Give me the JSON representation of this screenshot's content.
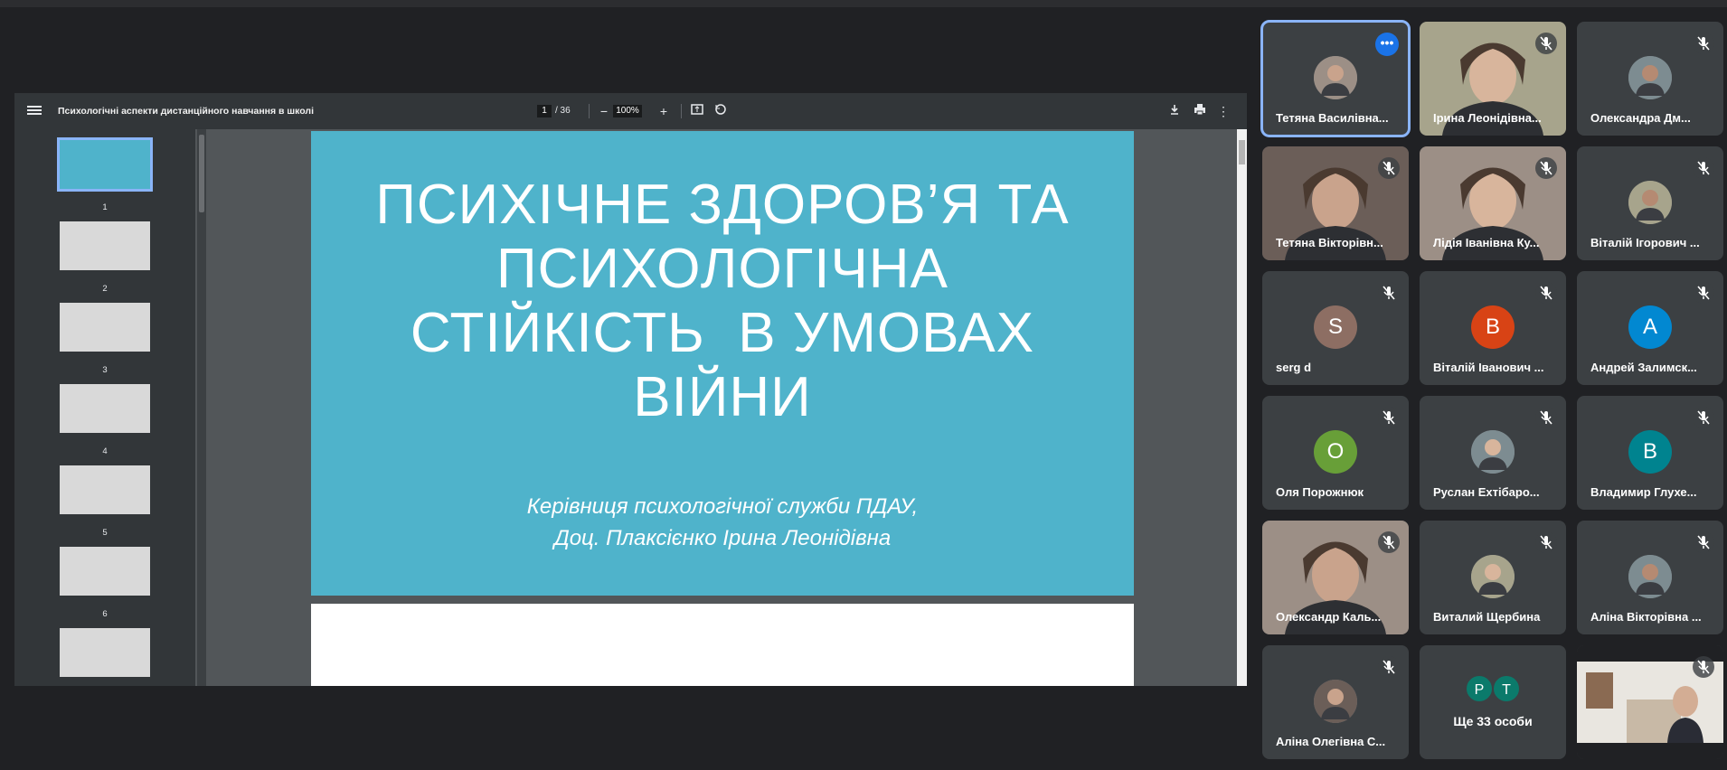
{
  "pdf": {
    "title": "Психологічні аспекти дистанційного навчання в школі",
    "current_page": "1",
    "page_total": "/ 36",
    "zoom": "100%",
    "thumbnails": [
      "1",
      "2",
      "3",
      "4",
      "5",
      "6"
    ],
    "slide": {
      "title_lines": [
        "ПСИХІЧНЕ ЗДОРОВ’Я ТА",
        "ПСИХОЛОГІЧНА",
        "СТІЙКІСТЬ  В УМОВАХ",
        "ВІЙНИ"
      ],
      "subtitle_lines": [
        "Керівниця психологічної служби ПДАУ,",
        "Доц. Плаксієнко Ірина Леонідівна"
      ],
      "background": "#4fb3cb"
    }
  },
  "participants": [
    {
      "name": "Тетяна Василівна...",
      "type": "photo-avatar",
      "active": true
    },
    {
      "name": "Ірина Леонідівна...",
      "type": "video"
    },
    {
      "name": "Олександра Дм...",
      "type": "photo-avatar"
    },
    {
      "name": "Тетяна Вікторівн...",
      "type": "video"
    },
    {
      "name": "Лідія Іванівна Ку...",
      "type": "video"
    },
    {
      "name": "Віталій Ігорович ...",
      "type": "photo-avatar"
    },
    {
      "name": "serg d",
      "type": "letter",
      "letter": "S",
      "color": "#8d6e63"
    },
    {
      "name": "Віталій Іванович ...",
      "type": "letter",
      "letter": "В",
      "color": "#d84315"
    },
    {
      "name": "Андрей Залимск...",
      "type": "letter",
      "letter": "А",
      "color": "#0288d1"
    },
    {
      "name": "Оля Порожнюк",
      "type": "letter",
      "letter": "О",
      "color": "#689f38"
    },
    {
      "name": "Руслан Ехтібаро...",
      "type": "photo-avatar"
    },
    {
      "name": "Владимир Глухе...",
      "type": "letter",
      "letter": "В",
      "color": "#00838f"
    },
    {
      "name": "Олександр Каль...",
      "type": "video"
    },
    {
      "name": "Виталий Щербина",
      "type": "photo-avatar"
    },
    {
      "name": "Аліна Вікторівна ...",
      "type": "photo-avatar"
    },
    {
      "name": "Аліна Олегівна С...",
      "type": "photo-avatar"
    },
    {
      "name": "Ще 33 особи",
      "type": "more",
      "letters": [
        "P",
        "T"
      ]
    },
    {
      "name": "",
      "type": "self-video"
    }
  ]
}
